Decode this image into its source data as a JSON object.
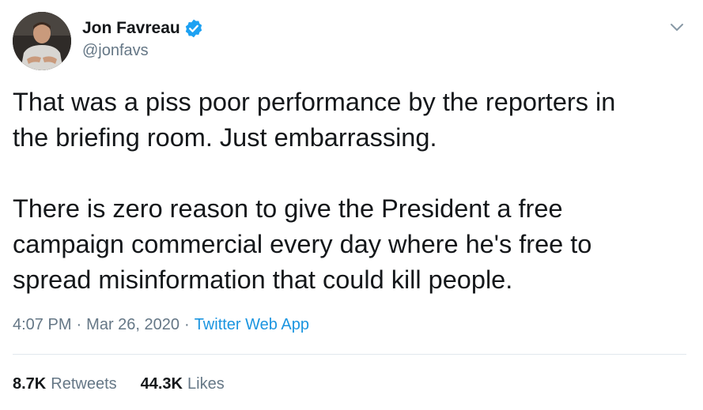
{
  "author": {
    "display_name": "Jon Favreau",
    "handle": "@jonfavs",
    "verified": true
  },
  "tweet": {
    "paragraphs": [
      [
        "That was a piss poor performance by the reporters in",
        "the briefing room. Just embarrassing."
      ],
      [
        "There is zero reason to give the President a free",
        "campaign commercial every day where he's free to",
        "spread misinformation that could kill people."
      ]
    ]
  },
  "meta": {
    "time": "4:07 PM",
    "separator": "·",
    "date": "Mar 26, 2020",
    "source": "Twitter Web App"
  },
  "stats": {
    "retweets_count": "8.7K",
    "retweets_label": "Retweets",
    "likes_count": "44.3K",
    "likes_label": "Likes"
  },
  "icons": {
    "verified": "verified-badge-icon",
    "menu": "chevron-down-icon"
  },
  "colors": {
    "text": "#14171a",
    "secondary": "#657786",
    "link": "#1b95e0",
    "verified": "#1da1f2",
    "divider": "#e1e8ed"
  }
}
